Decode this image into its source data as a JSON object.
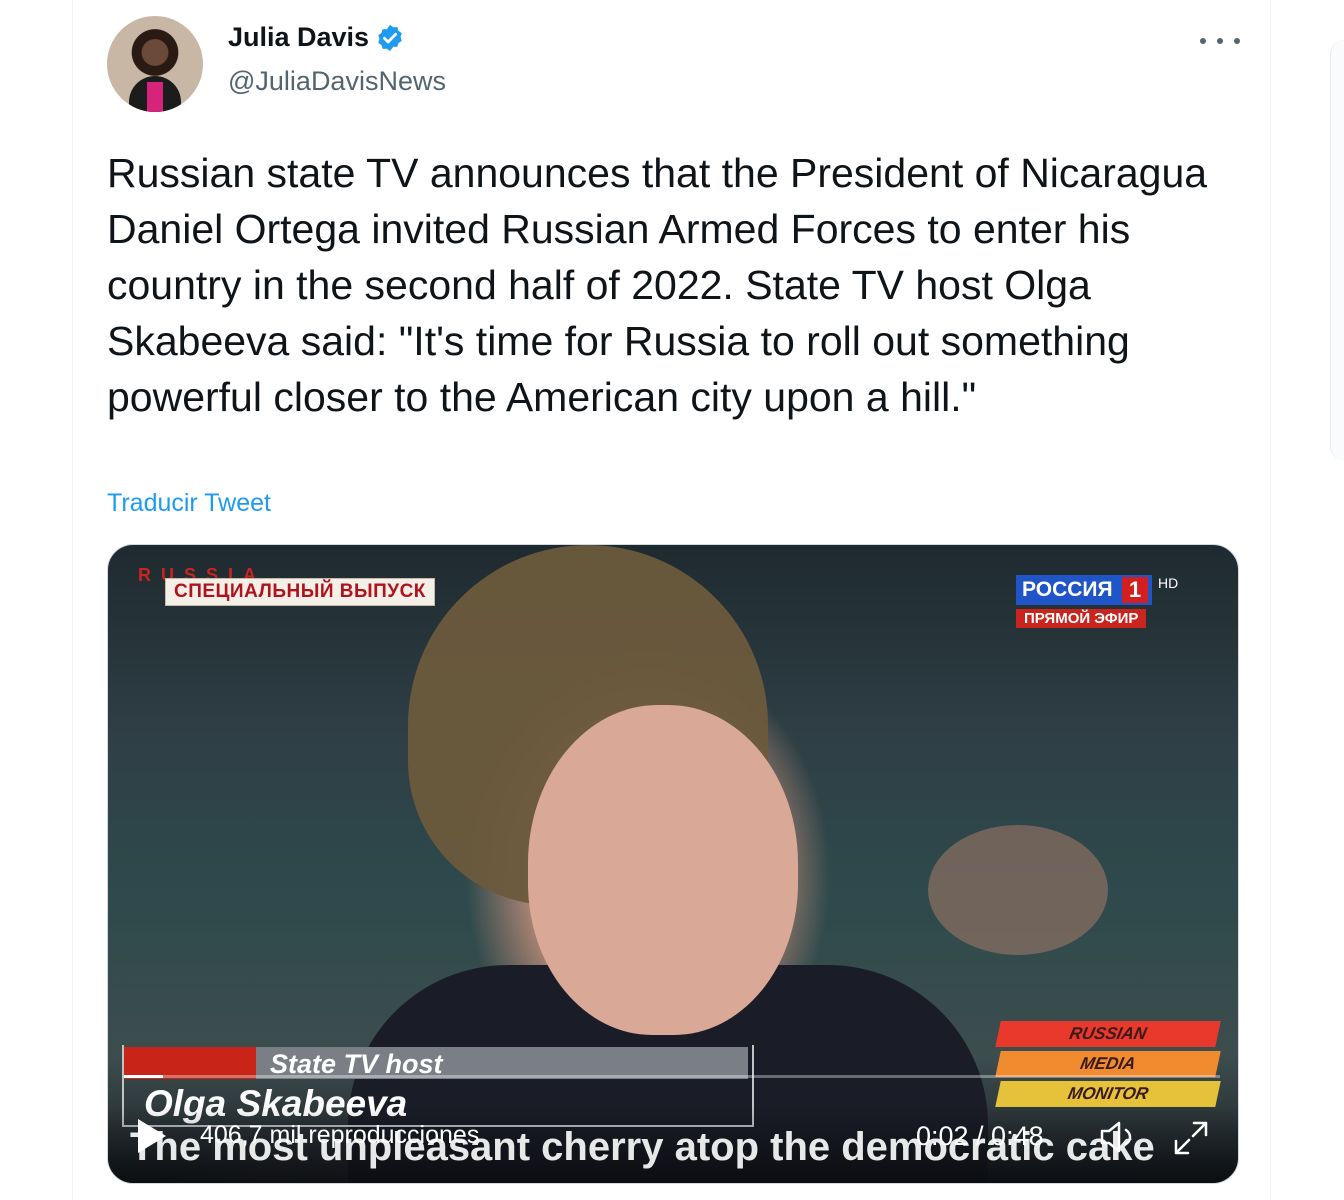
{
  "author": {
    "name": "Julia Davis",
    "handle": "@JuliaDavisNews",
    "verified_icon": "verified-badge-icon",
    "avatar_icon": "profile-avatar"
  },
  "menu_icon": "more-options-icon",
  "tweet": {
    "text": "Russian state TV announces that the President of Nicaragua Daniel Ortega invited Russian Armed Forces to enter his country in the second half of 2022. State TV host Olga Skabeeva said: \"It's time for Russia to roll out something powerful closer to the American city upon a hill.\"",
    "translate_label": "Traducir Tweet"
  },
  "video": {
    "broadcast_tag": "RUSSIA",
    "special_banner": "СПЕЦИАЛЬНЫЙ ВЫПУСК",
    "channel_name": "РОССИЯ",
    "channel_number": "1",
    "hd_label": "HD",
    "live_label": "ПРЯМОЙ ЭФИР",
    "monitor_lines": [
      {
        "text": "RUSSIAN",
        "color": "#e8392c"
      },
      {
        "text": "MEDIA",
        "color": "#f08b2f"
      },
      {
        "text": "MONITOR",
        "color": "#e6c23a"
      }
    ],
    "lower_third_role": "State TV  host",
    "lower_third_name": "Olga Skabeeva",
    "subtitle": "The most unpleasant cherry atop the democratic cake",
    "views": "406,7 mil reproducciones",
    "timecode": "0:02 / 0:48",
    "progress_fraction": 0.036,
    "controls": {
      "play": "play-icon",
      "volume": "volume-icon",
      "fullscreen": "fullscreen-icon"
    }
  },
  "colors": {
    "link": "#1d9bf0",
    "text": "#0f1419",
    "secondary_text": "#536471"
  }
}
